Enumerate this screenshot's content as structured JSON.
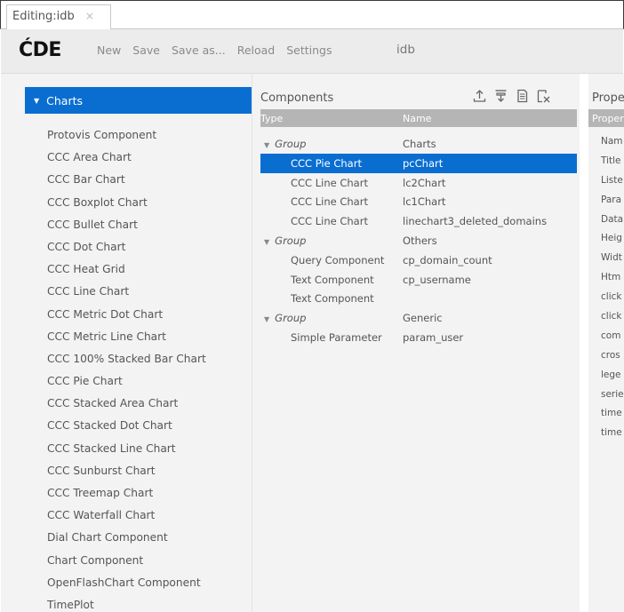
{
  "tab": {
    "title": "Editing:idb",
    "close": "×"
  },
  "header": {
    "logo": "ĆDE",
    "menu": [
      "New",
      "Save",
      "Save as...",
      "Reload",
      "Settings"
    ],
    "dashboard_name": "idb"
  },
  "left": {
    "section": "Charts",
    "items": [
      "Protovis Component",
      "CCC Area Chart",
      "CCC Bar Chart",
      "CCC Boxplot Chart",
      "CCC Bullet Chart",
      "CCC Dot Chart",
      "CCC Heat Grid",
      "CCC Line Chart",
      "CCC Metric Dot Chart",
      "CCC Metric Line Chart",
      "CCC 100% Stacked Bar Chart",
      "CCC Pie Chart",
      "CCC Stacked Area Chart",
      "CCC Stacked Dot Chart",
      "CCC Stacked Line Chart",
      "CCC Sunburst Chart",
      "CCC Treemap Chart",
      "CCC Waterfall Chart",
      "Dial Chart Component",
      "Chart Component",
      "OpenFlashChart Component",
      "TimePlot"
    ]
  },
  "components": {
    "title": "Components",
    "tools": [
      "upload-icon",
      "download-icon",
      "copy-icon",
      "clear-icon"
    ],
    "col_type": "Type",
    "col_name": "Name",
    "rows": [
      {
        "type": "Group",
        "name": "Charts",
        "kind": "group"
      },
      {
        "type": "CCC Pie Chart",
        "name": "pcChart",
        "kind": "child",
        "selected": true
      },
      {
        "type": "CCC Line Chart",
        "name": "lc2Chart",
        "kind": "child"
      },
      {
        "type": "CCC Line Chart",
        "name": "lc1Chart",
        "kind": "child"
      },
      {
        "type": "CCC Line Chart",
        "name": "linechart3_deleted_domains",
        "kind": "child"
      },
      {
        "type": "Group",
        "name": "Others",
        "kind": "group"
      },
      {
        "type": "Query Component",
        "name": "cp_domain_count",
        "kind": "child"
      },
      {
        "type": "Text Component",
        "name": "cp_username",
        "kind": "child"
      },
      {
        "type": "Text Component",
        "name": "",
        "kind": "child"
      },
      {
        "type": "Group",
        "name": "Generic",
        "kind": "group"
      },
      {
        "type": "Simple Parameter",
        "name": "param_user",
        "kind": "child"
      }
    ]
  },
  "properties": {
    "title": "Prope",
    "head": "Proper",
    "items": [
      "Nam",
      "Title",
      "Liste",
      "Para",
      "Data",
      "Heig",
      "Widt",
      "Htm",
      "click",
      "click",
      "com",
      "cros",
      "lege",
      "serie",
      "time",
      "time"
    ]
  },
  "colors": {
    "accent": "#0a6ed1",
    "panel": "#f3f3f3",
    "table_head": "#b5b5b5"
  }
}
